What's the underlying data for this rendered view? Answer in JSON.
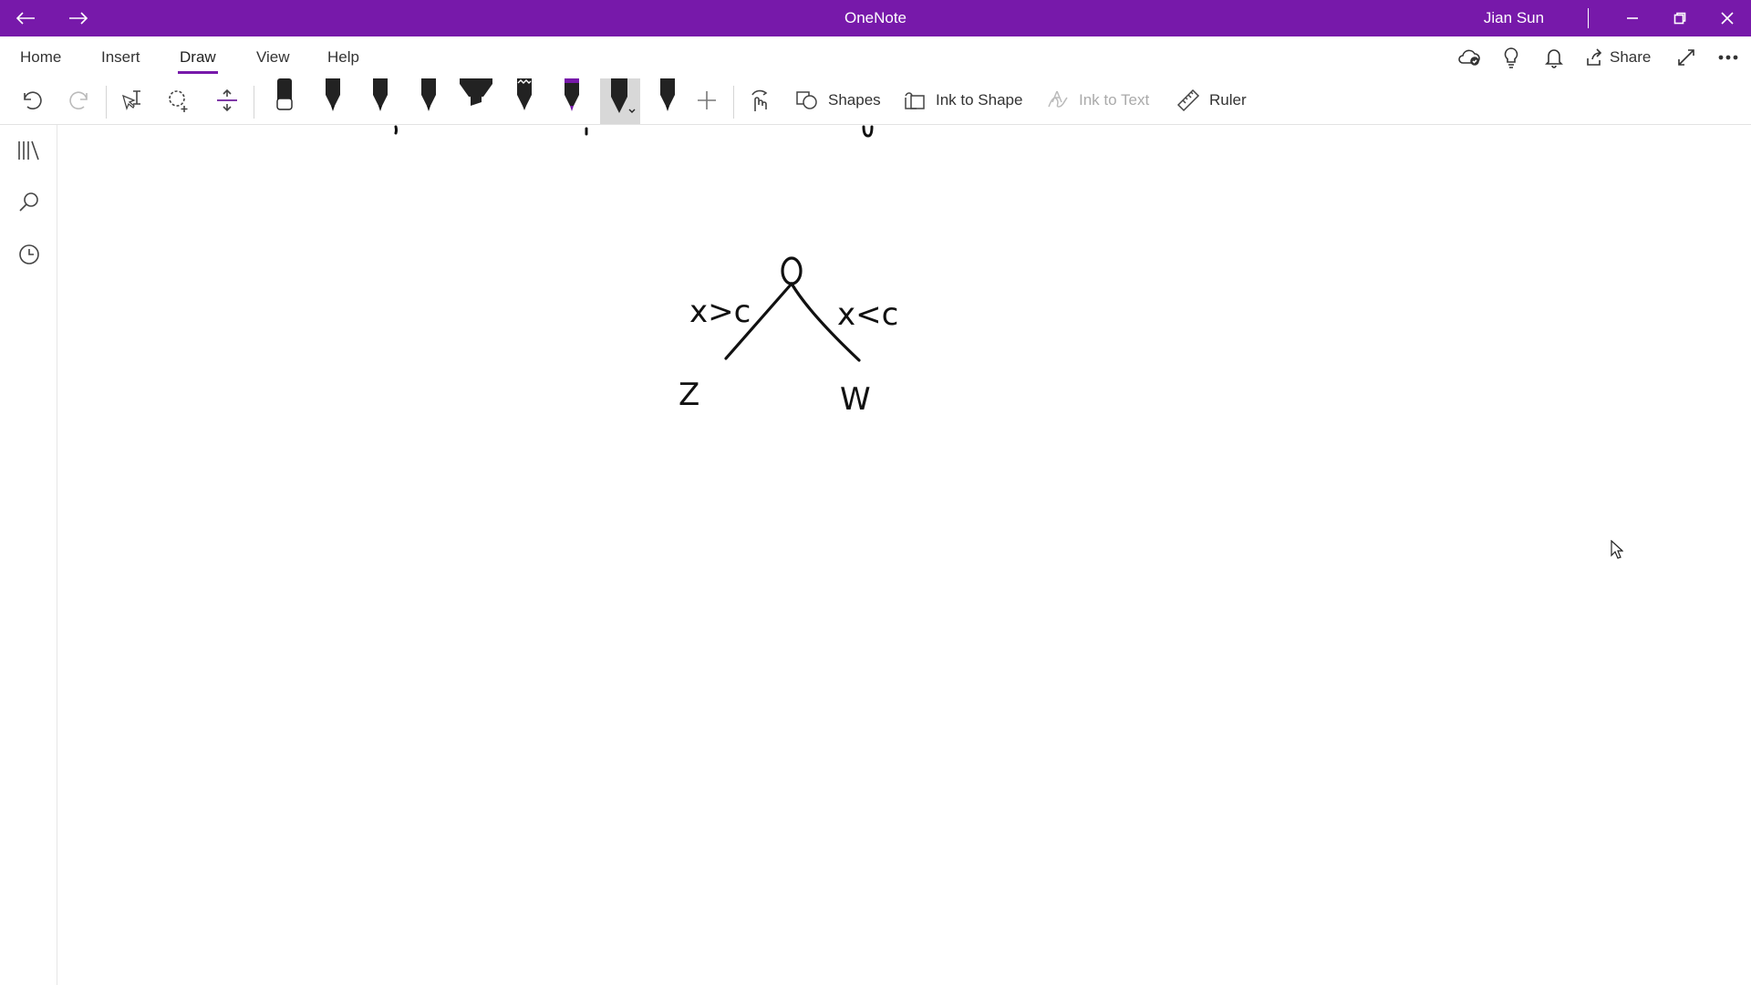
{
  "window": {
    "title": "OneNote",
    "user": "Jian Sun",
    "accent_color": "#7719aa",
    "nav": {
      "back_icon": "arrow-left-icon",
      "forward_icon": "arrow-right-icon"
    },
    "controls": [
      "minimize-icon",
      "restore-icon",
      "close-icon"
    ]
  },
  "menu": {
    "tabs": [
      {
        "label": "Home"
      },
      {
        "label": "Insert"
      },
      {
        "label": "Draw",
        "active": true
      },
      {
        "label": "View"
      },
      {
        "label": "Help"
      }
    ],
    "right": {
      "sync_icon": "cloud-sync-icon",
      "tips_icon": "lightbulb-icon",
      "notifications_icon": "bell-icon",
      "share_label": "Share",
      "fullscreen_icon": "expand-icon",
      "more_icon": "more-icon"
    }
  },
  "toolbar": {
    "undo_icon": "undo-icon",
    "redo_icon": "redo-icon",
    "pens": [
      {
        "name": "eraser",
        "tip": "#ffffff"
      },
      {
        "name": "pen-black-1",
        "tip": "#111111"
      },
      {
        "name": "pen-black-2",
        "tip": "#111111"
      },
      {
        "name": "pen-black-3",
        "tip": "#111111"
      },
      {
        "name": "highlighter",
        "tip": "#111111"
      },
      {
        "name": "pen-galaxy",
        "tip": "#111111"
      },
      {
        "name": "pen-purple",
        "tip": "#7719aa"
      },
      {
        "name": "pen-selected",
        "tip": "#111111"
      },
      {
        "name": "pen-black-4",
        "tip": "#111111"
      }
    ],
    "shapes_label": "Shapes",
    "ink_to_shape_label": "Ink to Shape",
    "ink_to_text_label": "Ink to Text",
    "ruler_label": "Ruler"
  },
  "sidebar": {
    "items": [
      "notebooks-icon",
      "search-icon",
      "recent-icon"
    ]
  },
  "canvas": {
    "ink_labels": {
      "left_branch": "x>c",
      "right_branch": "x<c",
      "left_leaf": "Z",
      "right_leaf": "W"
    }
  }
}
